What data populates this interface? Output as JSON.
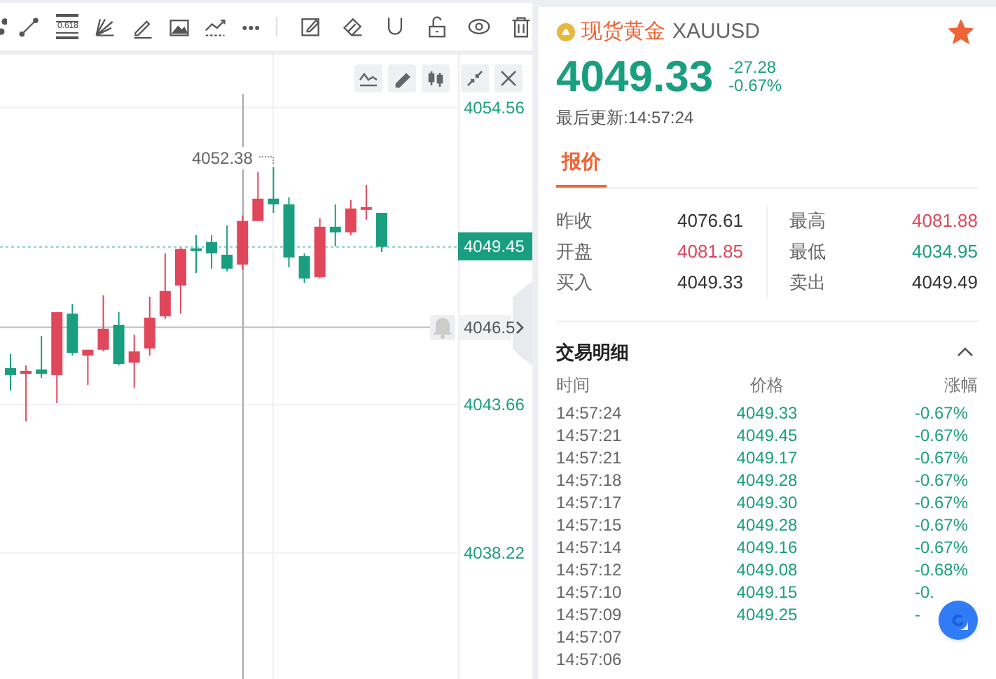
{
  "toolbar": {
    "fib_label": "0.618"
  },
  "chart": {
    "high_marker": "4052.38",
    "chart_data": {
      "type": "candlestick",
      "grid": true,
      "ylim": [
        4033.53,
        4056.51
      ],
      "yticks": [
        4054.56,
        4043.66,
        4038.22
      ],
      "ref_lines": [
        {
          "axis": "y",
          "value": 4049.45,
          "label": "4049.45"
        },
        {
          "axis": "y",
          "value": 4046.5,
          "label": "4046.5"
        }
      ],
      "ohlc": [
        [
          4045.0,
          4045.51,
          4044.18,
          4044.74
        ],
        [
          4044.84,
          4045.1,
          4043.04,
          4044.84
        ],
        [
          4044.95,
          4046.18,
          4044.64,
          4044.79
        ],
        [
          4044.74,
          4047.05,
          4043.71,
          4047.05
        ],
        [
          4047.0,
          4047.36,
          4045.46,
          4045.56
        ],
        [
          4045.46,
          4045.67,
          4044.38,
          4045.67
        ],
        [
          4045.67,
          4047.67,
          4045.61,
          4046.44
        ],
        [
          4046.59,
          4047.05,
          4045.1,
          4045.15
        ],
        [
          4045.2,
          4046.23,
          4044.28,
          4045.61
        ],
        [
          4045.72,
          4047.62,
          4045.46,
          4046.85
        ],
        [
          4046.9,
          4049.21,
          4046.8,
          4047.83
        ],
        [
          4048.03,
          4049.42,
          4047.0,
          4049.37
        ],
        [
          4049.37,
          4049.88,
          4048.49,
          4049.32
        ],
        [
          4049.63,
          4049.88,
          4048.65,
          4049.21
        ],
        [
          4049.16,
          4050.24,
          4048.55,
          4048.65
        ],
        [
          4048.8,
          4050.6,
          4048.6,
          4050.4
        ],
        [
          4050.4,
          4052.2,
          4050.4,
          4051.22
        ],
        [
          4051.22,
          4052.38,
          4050.7,
          4051.01
        ],
        [
          4051.01,
          4051.27,
          4048.7,
          4049.06
        ],
        [
          4049.11,
          4049.21,
          4048.13,
          4048.29
        ],
        [
          4048.34,
          4050.5,
          4048.29,
          4050.19
        ],
        [
          4050.19,
          4051.01,
          4049.47,
          4049.98
        ],
        [
          4049.98,
          4051.17,
          4049.88,
          4050.86
        ],
        [
          4050.86,
          4051.73,
          4050.45,
          4050.86
        ],
        [
          4050.7,
          4050.7,
          4049.26,
          4049.45
        ]
      ]
    }
  },
  "quote": {
    "name": "现货黄金",
    "symbol": "XAUUSD",
    "favorite": true,
    "price": "4049.33",
    "change": "-27.28",
    "change_pct": "-0.67%",
    "updated": "最后更新:14:57:24"
  },
  "tabs": [
    {
      "label": "报价",
      "selected": true
    }
  ],
  "stats": [
    {
      "label": "昨收",
      "value": "4076.61",
      "color": "#333333"
    },
    {
      "label": "最高",
      "value": "4081.88",
      "color": "#e0475b"
    },
    {
      "label": "开盘",
      "value": "4081.85",
      "color": "#e0475b"
    },
    {
      "label": "最低",
      "value": "4034.95",
      "color": "#1a9e80"
    },
    {
      "label": "买入",
      "value": "4049.33",
      "color": "#333333"
    },
    {
      "label": "卖出",
      "value": "4049.49",
      "color": "#333333"
    }
  ],
  "trades": {
    "title": "交易明细",
    "expanded": true,
    "columns": [
      "时间",
      "价格",
      "涨幅"
    ],
    "rows": [
      {
        "time": "14:57:24",
        "price": "4049.33",
        "change": "-0.67%"
      },
      {
        "time": "14:57:21",
        "price": "4049.45",
        "change": "-0.67%"
      },
      {
        "time": "14:57:21",
        "price": "4049.17",
        "change": "-0.67%"
      },
      {
        "time": "14:57:18",
        "price": "4049.28",
        "change": "-0.67%"
      },
      {
        "time": "14:57:17",
        "price": "4049.30",
        "change": "-0.67%"
      },
      {
        "time": "14:57:15",
        "price": "4049.28",
        "change": "-0.67%"
      },
      {
        "time": "14:57:14",
        "price": "4049.16",
        "change": "-0.67%"
      },
      {
        "time": "14:57:12",
        "price": "4049.08",
        "change": "-0.68%"
      },
      {
        "time": "14:57:10",
        "price": "4049.15",
        "change": "-0."
      },
      {
        "time": "14:57:09",
        "price": "4049.25",
        "change": "-"
      },
      {
        "time": "14:57:07"
      },
      {
        "time": "14:57:06"
      }
    ]
  }
}
